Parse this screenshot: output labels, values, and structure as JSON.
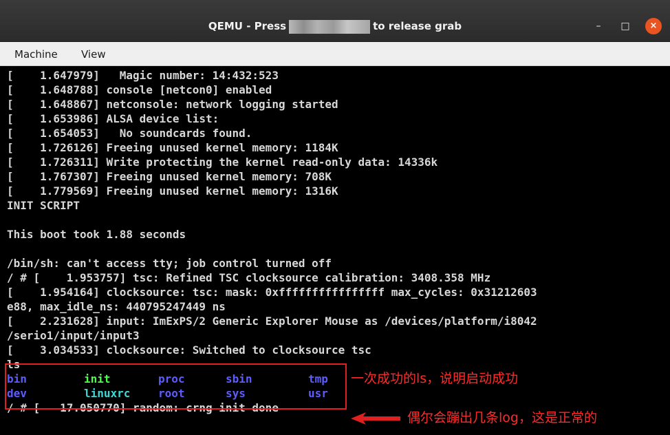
{
  "window": {
    "title_prefix": "QEMU - Press",
    "title_suffix": "to release grab",
    "btn_min": "–",
    "btn_max": "□",
    "btn_close": "×"
  },
  "menu": {
    "machine": "Machine",
    "view": "View"
  },
  "console": {
    "lines": [
      "[    1.647979]   Magic number: 14:432:523",
      "[    1.648788] console [netcon0] enabled",
      "[    1.648867] netconsole: network logging started",
      "[    1.653986] ALSA device list:",
      "[    1.654053]   No soundcards found.",
      "[    1.726126] Freeing unused kernel memory: 1184K",
      "[    1.726311] Write protecting the kernel read-only data: 14336k",
      "[    1.767307] Freeing unused kernel memory: 708K",
      "[    1.779569] Freeing unused kernel memory: 1316K",
      "INIT SCRIPT",
      "",
      "This boot took 1.88 seconds",
      "",
      "/bin/sh: can't access tty; job control turned off",
      "/ # [    1.953757] tsc: Refined TSC clocksource calibration: 3408.358 MHz",
      "[    1.954164] clocksource: tsc: mask: 0xffffffffffffffff max_cycles: 0x31212603",
      "e88, max_idle_ns: 440795247449 ns",
      "[    2.231628] input: ImExPS/2 Generic Explorer Mouse as /devices/platform/i8042",
      "/serio1/input/input3",
      "[    3.034533] clocksource: Switched to clocksource tsc",
      "ls"
    ],
    "ls_rows": [
      [
        "bin",
        "init",
        "proc",
        "sbin",
        "tmp"
      ],
      [
        "dev",
        "linuxrc",
        "root",
        "sys",
        "usr"
      ]
    ],
    "last_line": "/ # [   17.050770] random: crng init done"
  },
  "colors": {
    "dir": "#5c5cff",
    "exec": "#4cff4c",
    "link": "#3fd8d8",
    "annotation": "#ff2a2a"
  },
  "annotations": {
    "ls_note": "一次成功的ls，说明启动成功",
    "log_note": "偶尔会蹦出几条log，这是正常的"
  }
}
